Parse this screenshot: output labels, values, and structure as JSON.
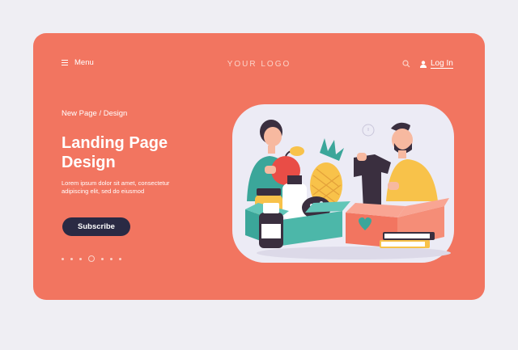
{
  "header": {
    "menu_label": "Menu",
    "logo_text": "YOUR LOGO",
    "login_label": "Log In"
  },
  "hero": {
    "breadcrumb": "New Page / Design",
    "title": "Landing Page Design",
    "body_line1": "Lorem ipsum dolor sit amet, consectetur",
    "body_line2": "adipiscing elit, sed do eiusmod",
    "subscribe_label": "Subscribe"
  },
  "pagination": {
    "count": 7,
    "active_index": 3
  },
  "icons": [
    "hamburger-icon",
    "search-icon",
    "user-icon"
  ],
  "colors": {
    "background": "#efeef3",
    "card": "#f27560",
    "button": "#2a2a44",
    "illustration_bg": "#ecebf5"
  }
}
